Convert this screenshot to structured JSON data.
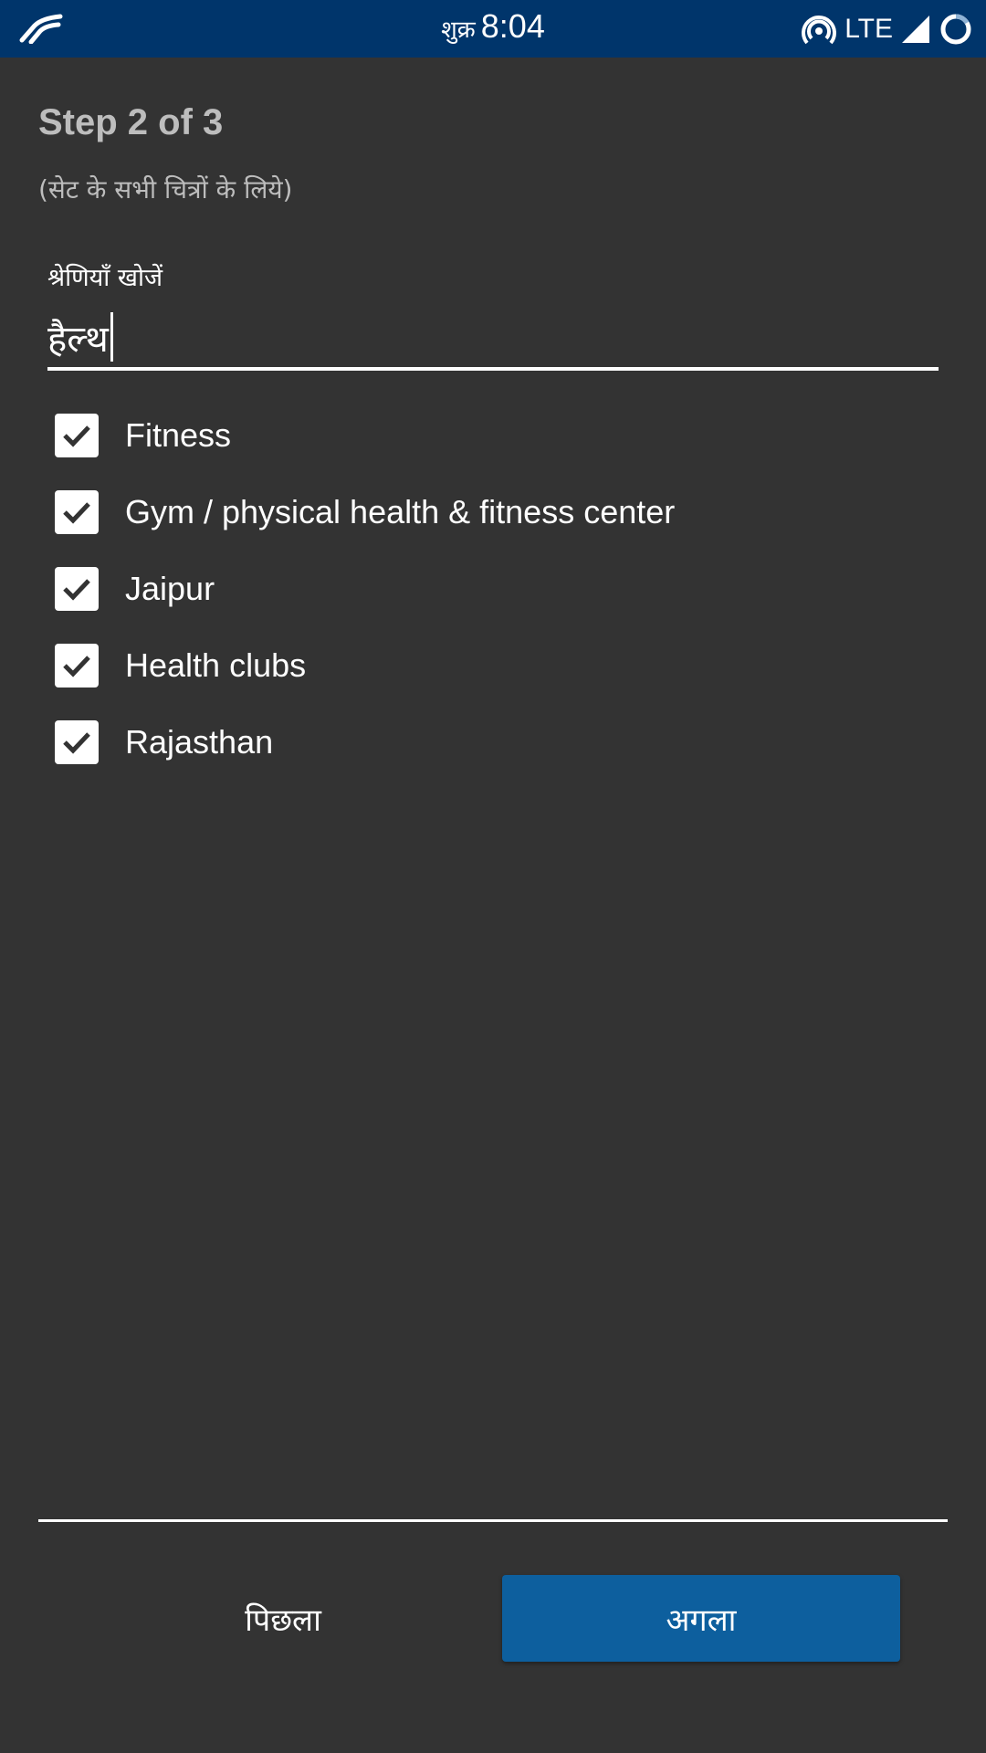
{
  "status_bar": {
    "day": "शुक्र",
    "time": "8:04",
    "network": "LTE",
    "icons": [
      "app-logo-icon",
      "hotspot-icon",
      "signal-icon",
      "loading-circle-icon"
    ]
  },
  "wizard": {
    "step": "Step 2 of 3",
    "subtitle": "(सेट के सभी चित्रों के लिये)"
  },
  "search": {
    "label": "श्रेणियाँ खोजें",
    "value": "हैल्थ"
  },
  "categories": [
    {
      "label": "Fitness",
      "checked": true
    },
    {
      "label": "Gym / physical health & fitness center",
      "checked": true
    },
    {
      "label": "Jaipur",
      "checked": true
    },
    {
      "label": "Health clubs",
      "checked": true
    },
    {
      "label": "Rajasthan",
      "checked": true
    }
  ],
  "footer": {
    "prev_label": "पिछला",
    "next_label": "अगला"
  },
  "colors": {
    "background": "#333333",
    "status_bar": "#00356b",
    "primary_button": "#0d5f9e"
  }
}
